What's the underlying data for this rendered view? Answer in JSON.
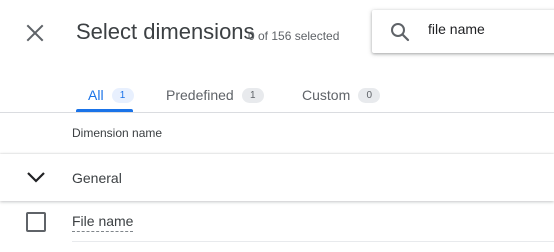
{
  "header": {
    "title": "Select dimensions",
    "selection_count": "0 of 156 selected",
    "close_icon": "close-icon"
  },
  "search": {
    "icon": "search-icon",
    "value": "file name",
    "placeholder": ""
  },
  "tabs": [
    {
      "label": "All",
      "count": "1",
      "active": true
    },
    {
      "label": "Predefined",
      "count": "1",
      "active": false
    },
    {
      "label": "Custom",
      "count": "0",
      "active": false
    }
  ],
  "table": {
    "column_header": "Dimension name",
    "group": {
      "label": "General",
      "expanded": true,
      "icon": "chevron-down-icon"
    },
    "items": [
      {
        "label": "File name",
        "checked": false
      }
    ]
  },
  "colors": {
    "accent": "#1a73e8",
    "text_primary": "#3c4043",
    "text_secondary": "#5f6368"
  }
}
